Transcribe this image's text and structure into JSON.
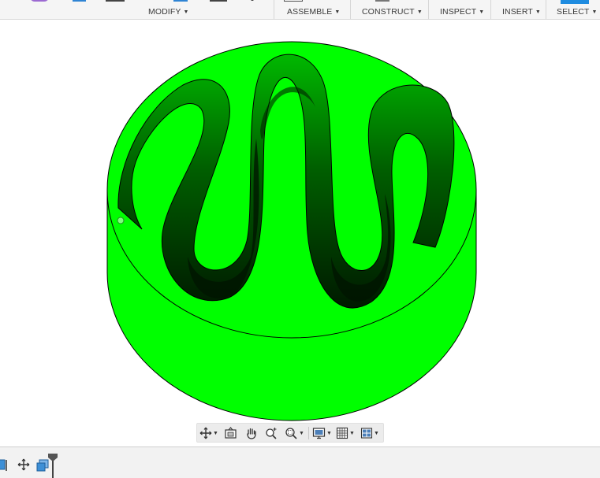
{
  "toolbar": {
    "menus": [
      {
        "label": "MODIFY"
      },
      {
        "label": "ASSEMBLE"
      },
      {
        "label": "CONSTRUCT"
      },
      {
        "label": "INSPECT"
      },
      {
        "label": "INSERT"
      },
      {
        "label": "SELECT"
      }
    ],
    "icons": [
      "sketch-icon",
      "extrude-icon",
      "press-pull-icon",
      "fillet-icon",
      "shell-icon",
      "point-icon",
      "joint-icon",
      "plane-icon",
      "select-icon"
    ]
  },
  "viewport": {
    "model": "green-cylinder-with-serpentine-channel",
    "colors": {
      "body": "#00ff00",
      "channel_shadow": "#003300",
      "edges": "#000000",
      "background": "#ffffff"
    }
  },
  "navbar": {
    "tools": [
      {
        "name": "orbit-icon",
        "has_menu": true
      },
      {
        "name": "look-at-icon",
        "has_menu": false
      },
      {
        "name": "pan-hand-icon",
        "has_menu": false
      },
      {
        "name": "zoom-icon",
        "has_menu": false
      },
      {
        "name": "zoom-window-icon",
        "has_menu": true
      },
      {
        "name": "display-settings-icon",
        "has_menu": true
      },
      {
        "name": "grid-icon",
        "has_menu": true
      },
      {
        "name": "viewports-icon",
        "has_menu": true
      }
    ]
  },
  "timeline": {
    "items": [
      "component-icon",
      "move-icon",
      "body-feature-icon"
    ],
    "marker": "timeline-marker-icon"
  }
}
